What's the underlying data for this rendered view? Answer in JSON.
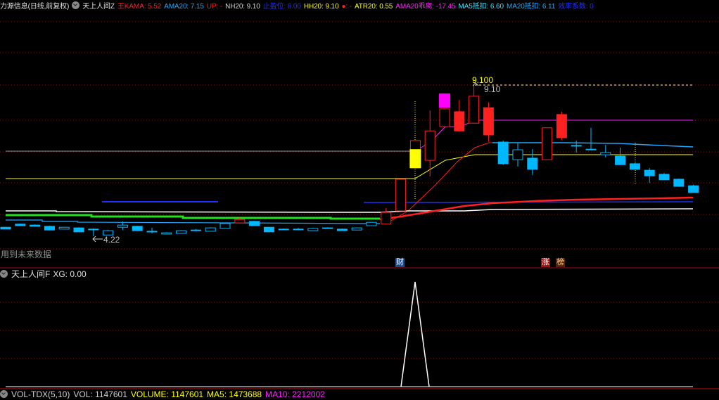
{
  "header": {
    "title": "力源信息(日线,前复权)",
    "indicator": "天上人间Z",
    "items": [
      {
        "label": "王KAMA: 5.52",
        "color": "#ff2020"
      },
      {
        "label": "AMA20: 7.15",
        "color": "#20a8ff"
      },
      {
        "label": "UP: -",
        "color": "#ff2020"
      },
      {
        "label": "NH20: 9.10",
        "color": "#d0d0d0"
      },
      {
        "label": "止盈位: 8.00",
        "color": "#2030ff"
      },
      {
        "label": "HH20: 9.10",
        "color": "#ffff00"
      },
      {
        "label": "●: -",
        "color": "#ff2020"
      },
      {
        "label": "ATR20: 0.55",
        "color": "#ffff00"
      },
      {
        "label": "AMA20乖离: -17.45",
        "color": "#ff20ff"
      },
      {
        "label": "MA5抵扣: 6.60",
        "color": "#40e0ff"
      },
      {
        "label": "MA20抵扣: 6.11",
        "color": "#20a8ff"
      },
      {
        "label": "效率系数: 0",
        "color": "#2030ff"
      }
    ]
  },
  "main": {
    "high_label": "9.100",
    "high_arrow": "9.10",
    "low_arrow": "4.22",
    "warning": "用到未来数据",
    "tags": [
      {
        "text": "财",
        "color": "#ffffff",
        "bg": "#1a4a8a"
      },
      {
        "text": "涨",
        "color": "#ffffff",
        "bg": "#a01010"
      },
      {
        "text": "榜",
        "color": "#ffd080",
        "bg": "#502010"
      }
    ]
  },
  "sub_pane": {
    "title": "天上人间F",
    "value": "XG: 0.00"
  },
  "volume_pane": {
    "title": "VOL-TDX(5,10)",
    "items": [
      {
        "label": "VOL: 1147601",
        "color": "#d0d0d0"
      },
      {
        "label": "VOLUME: 1147601",
        "color": "#ffff00"
      },
      {
        "label": "MA5: 1473688",
        "color": "#ffff00"
      },
      {
        "label": "MA10: 2212002",
        "color": "#ff20ff"
      }
    ]
  },
  "colors": {
    "up": "#ff2020",
    "down": "#00b8ff",
    "bg": "#000000",
    "grid": "#8a1010"
  },
  "candles": [
    {
      "o": 4.51,
      "h": 4.52,
      "l": 4.44,
      "c": 4.45,
      "s": "down"
    },
    {
      "o": 4.61,
      "h": 4.63,
      "l": 4.55,
      "c": 4.56,
      "s": "down"
    },
    {
      "o": 4.58,
      "h": 4.6,
      "l": 4.53,
      "c": 4.54,
      "s": "down"
    },
    {
      "o": 4.54,
      "h": 4.56,
      "l": 4.42,
      "c": 4.42,
      "s": "down"
    },
    {
      "o": 4.51,
      "h": 4.52,
      "l": 4.44,
      "c": 4.45,
      "s": "hollow-blue"
    },
    {
      "o": 4.49,
      "h": 4.51,
      "l": 4.36,
      "c": 4.36,
      "s": "down"
    },
    {
      "o": 4.45,
      "h": 4.47,
      "l": 4.22,
      "c": 4.45,
      "s": "down"
    },
    {
      "o": 4.4,
      "h": 4.43,
      "l": 4.26,
      "c": 4.26,
      "s": "hollow-blue"
    },
    {
      "o": 4.58,
      "h": 4.7,
      "l": 4.42,
      "c": 4.51,
      "s": "hollow-blue"
    },
    {
      "o": 4.54,
      "h": 4.56,
      "l": 4.4,
      "c": 4.4,
      "s": "down"
    },
    {
      "o": 4.38,
      "h": 4.49,
      "l": 4.31,
      "c": 4.38,
      "s": "down"
    },
    {
      "o": 4.33,
      "h": 4.35,
      "l": 4.28,
      "c": 4.29,
      "s": "hollow-blue"
    },
    {
      "o": 4.4,
      "h": 4.42,
      "l": 4.31,
      "c": 4.31,
      "s": "hollow-blue"
    },
    {
      "o": 4.42,
      "h": 4.45,
      "l": 4.4,
      "c": 4.42,
      "s": "down"
    },
    {
      "o": 4.49,
      "h": 4.51,
      "l": 4.38,
      "c": 4.38,
      "s": "hollow-blue"
    },
    {
      "o": 4.63,
      "h": 4.63,
      "l": 4.47,
      "c": 4.47,
      "s": "hollow-blue"
    },
    {
      "o": 4.65,
      "h": 4.81,
      "l": 4.63,
      "c": 4.76,
      "s": "up"
    },
    {
      "o": 4.7,
      "h": 4.72,
      "l": 4.56,
      "c": 4.56,
      "s": "down"
    },
    {
      "o": 4.51,
      "h": 4.52,
      "l": 4.36,
      "c": 4.36,
      "s": "down"
    },
    {
      "o": 4.45,
      "h": 4.47,
      "l": 4.42,
      "c": 4.45,
      "s": "down"
    },
    {
      "o": 4.45,
      "h": 4.49,
      "l": 4.42,
      "c": 4.45,
      "s": "down"
    },
    {
      "o": 4.47,
      "h": 4.49,
      "l": 4.4,
      "c": 4.4,
      "s": "hollow-blue"
    },
    {
      "o": 4.49,
      "h": 4.51,
      "l": 4.47,
      "c": 4.49,
      "s": "down"
    },
    {
      "o": 4.45,
      "h": 4.47,
      "l": 4.4,
      "c": 4.4,
      "s": "down"
    },
    {
      "o": 4.49,
      "h": 4.49,
      "l": 4.42,
      "c": 4.42,
      "s": "hollow-blue"
    },
    {
      "o": 4.56,
      "h": 4.67,
      "l": 4.56,
      "c": 4.67,
      "s": "hollow-blue"
    },
    {
      "o": 4.61,
      "h": 5.13,
      "l": 4.61,
      "c": 4.99,
      "s": "up"
    },
    {
      "o": 5.04,
      "h": 6.06,
      "l": 5.04,
      "c": 6.06,
      "s": "up"
    },
    {
      "o": 6.42,
      "h": 7.31,
      "l": 6.42,
      "c": 7.03,
      "s": "yellow"
    },
    {
      "o": 6.67,
      "h": 8.28,
      "l": 6.15,
      "c": 7.62,
      "s": "up"
    },
    {
      "o": 7.76,
      "h": 8.33,
      "l": 7.76,
      "c": 8.33,
      "s": "magenta"
    },
    {
      "o": 8.24,
      "h": 8.62,
      "l": 7.6,
      "c": 7.62,
      "s": "red-filled"
    },
    {
      "o": 7.87,
      "h": 9.1,
      "l": 7.87,
      "c": 8.74,
      "s": "up"
    },
    {
      "o": 8.37,
      "h": 8.55,
      "l": 7.28,
      "c": 7.49,
      "s": "red-filled"
    },
    {
      "o": 7.26,
      "h": 7.31,
      "l": 6.52,
      "c": 6.56,
      "s": "down"
    },
    {
      "o": 7.01,
      "h": 7.24,
      "l": 6.47,
      "c": 6.69,
      "s": "hollow-blue"
    },
    {
      "o": 6.74,
      "h": 7.03,
      "l": 6.2,
      "c": 6.38,
      "s": "down"
    },
    {
      "o": 6.69,
      "h": 7.72,
      "l": 6.67,
      "c": 7.72,
      "s": "up"
    },
    {
      "o": 8.15,
      "h": 8.24,
      "l": 7.33,
      "c": 7.4,
      "s": "red-filled"
    },
    {
      "o": 7.15,
      "h": 7.31,
      "l": 6.92,
      "c": 7.15,
      "s": "down"
    },
    {
      "o": 7.03,
      "h": 7.72,
      "l": 6.99,
      "c": 7.03,
      "s": "down"
    },
    {
      "o": 6.92,
      "h": 7.17,
      "l": 6.76,
      "c": 6.85,
      "s": "hollow-blue"
    },
    {
      "o": 6.81,
      "h": 7.08,
      "l": 6.53,
      "c": 6.53,
      "s": "down"
    },
    {
      "o": 6.56,
      "h": 6.58,
      "l": 6.38,
      "c": 6.38,
      "s": "down"
    },
    {
      "o": 6.35,
      "h": 6.42,
      "l": 5.94,
      "c": 6.17,
      "s": "down"
    },
    {
      "o": 6.22,
      "h": 6.26,
      "l": 6.04,
      "c": 6.04,
      "s": "down"
    },
    {
      "o": 6.06,
      "h": 6.08,
      "l": 5.83,
      "c": 5.83,
      "s": "down"
    },
    {
      "o": 5.85,
      "h": 5.88,
      "l": 5.63,
      "c": 5.63,
      "s": "down"
    }
  ]
}
